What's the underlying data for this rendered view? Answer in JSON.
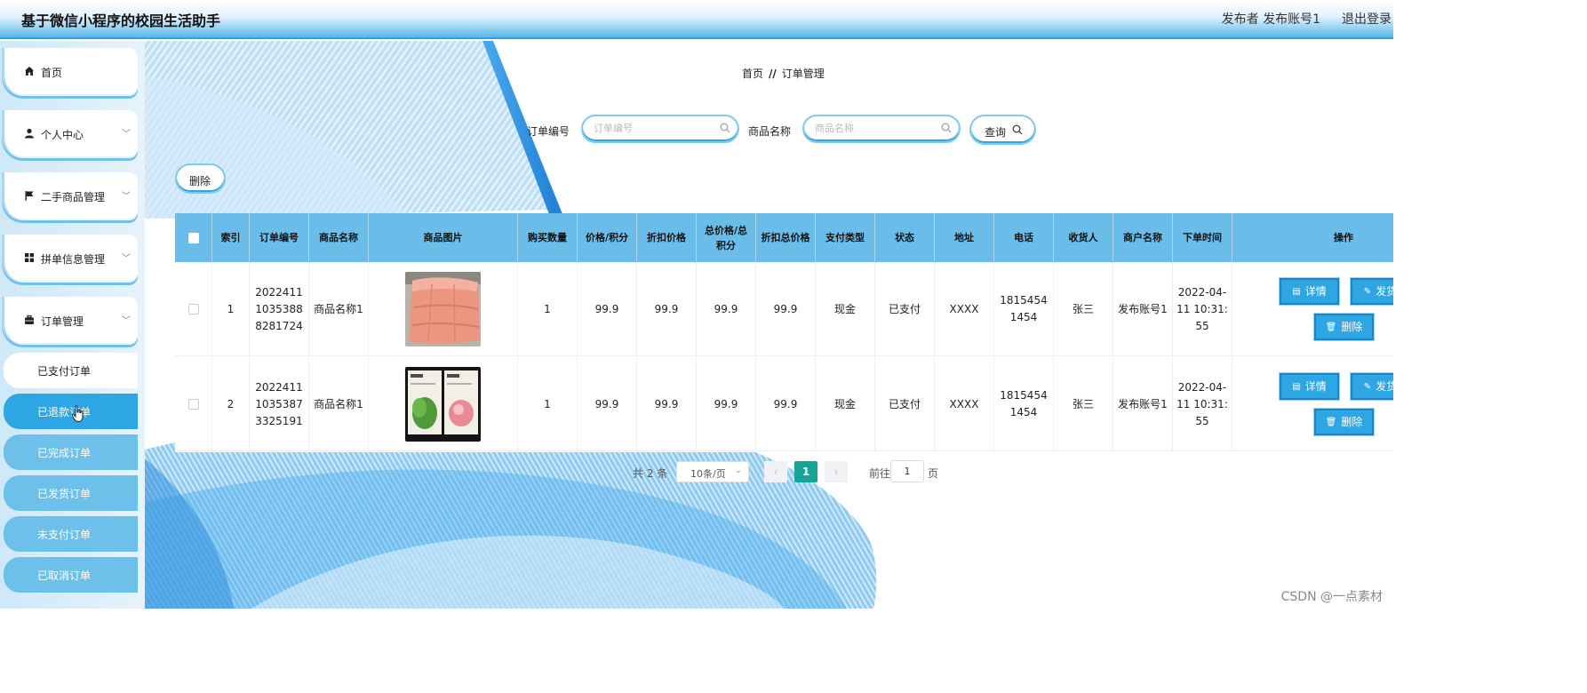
{
  "header": {
    "title": "基于微信小程序的校园生活助手",
    "user": "发布者 发布账号1",
    "logout": "退出登录"
  },
  "sidebar": {
    "items": [
      {
        "label": "首页",
        "icon": "home-icon"
      },
      {
        "label": "个人中心",
        "icon": "user-icon"
      },
      {
        "label": "二手商品管理",
        "icon": "flag-icon"
      },
      {
        "label": "拼单信息管理",
        "icon": "grid-icon"
      },
      {
        "label": "订单管理",
        "icon": "briefcase-icon"
      }
    ],
    "subitems": [
      "已支付订单",
      "已退款订单",
      "已完成订单",
      "已发货订单",
      "未支付订单",
      "已取消订单"
    ]
  },
  "breadcrumb": {
    "home": "首页",
    "sep": "//",
    "current": "订单管理"
  },
  "search": {
    "order_label": "订单编号",
    "order_placeholder": "订单编号",
    "name_label": "商品名称",
    "name_placeholder": "商品名称",
    "query_button": "查询"
  },
  "actions": {
    "delete": "删除"
  },
  "table": {
    "headers": [
      "索引",
      "订单编号",
      "商品名称",
      "商品图片",
      "购买数量",
      "价格/积分",
      "折扣价格",
      "总价格/总积分",
      "折扣总价格",
      "支付类型",
      "状态",
      "地址",
      "电话",
      "收货人",
      "商户名称",
      "下单时间",
      "操作"
    ],
    "rows": [
      {
        "index": "1",
        "order_no": "20224111035388 8281724",
        "name": "商品名称1",
        "qty": "1",
        "price": "99.9",
        "discount": "99.9",
        "total": "99.9",
        "discount_total": "99.9",
        "pay_type": "现金",
        "status": "已支付",
        "address": "XXXX",
        "phone": "18154541454",
        "receiver": "张三",
        "merchant": "发布账号1",
        "time": "2022-04-11 10:31:55"
      },
      {
        "index": "2",
        "order_no": "20224111035387 3325191",
        "name": "商品名称1",
        "qty": "1",
        "price": "99.9",
        "discount": "99.9",
        "total": "99.9",
        "discount_total": "99.9",
        "pay_type": "现金",
        "status": "已支付",
        "address": "XXXX",
        "phone": "18154541454",
        "receiver": "张三",
        "merchant": "发布账号1",
        "time": "2022-04-11 10:31:55"
      }
    ],
    "op_detail": "详情",
    "op_ship": "发货",
    "op_delete": "删除"
  },
  "pagination": {
    "total": "共 2 条",
    "page_size": "10条/页",
    "current": "1",
    "goto_prefix": "前往",
    "goto_value": "1",
    "goto_suffix": "页"
  },
  "watermark": "CSDN @一点素材",
  "colors": {
    "accent": "#2ea6e3",
    "header_row": "#69bde8",
    "current_page": "#17a398"
  }
}
